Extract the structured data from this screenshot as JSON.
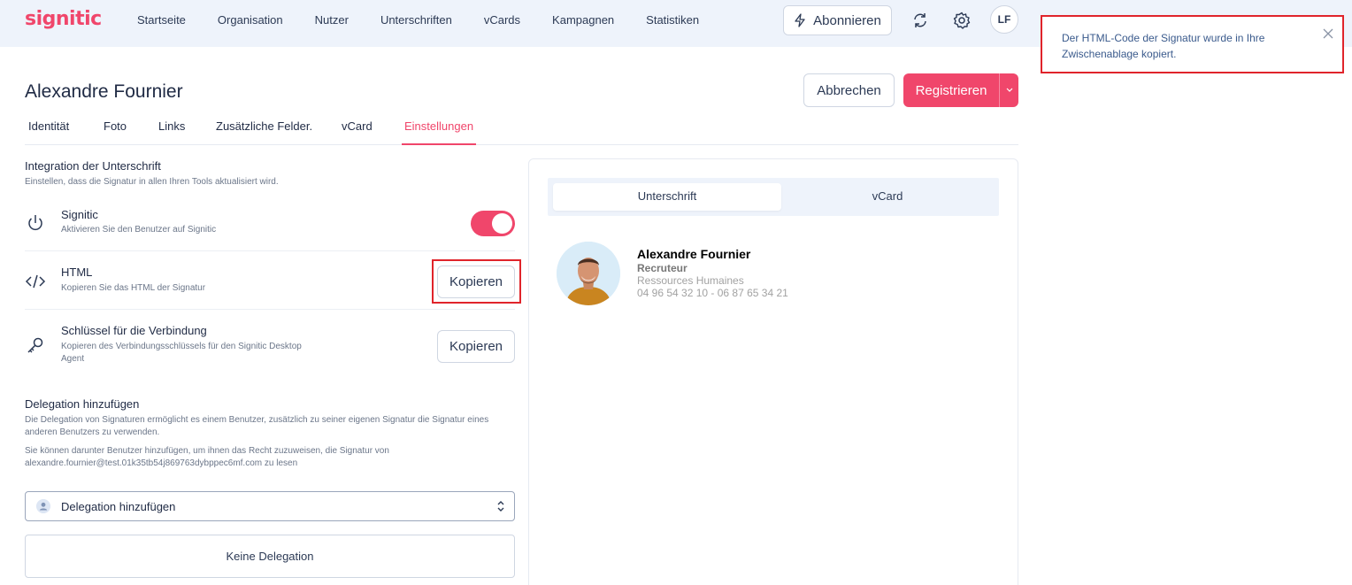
{
  "brand": {
    "name": "signitic",
    "accent": "#f0466b"
  },
  "nav": {
    "items": [
      "Startseite",
      "Organisation",
      "Nutzer",
      "Unterschriften",
      "vCards",
      "Kampagnen",
      "Statistiken"
    ],
    "subscribe_label": "Abonnieren",
    "user_initials": "LF"
  },
  "toast": {
    "message": "Der HTML-Code der Signatur wurde in Ihre Zwischenablage kopiert."
  },
  "header": {
    "title": "Alexandre Fournier",
    "cancel_label": "Abbrechen",
    "save_label": "Registrieren"
  },
  "tabs": [
    "Identität",
    "Foto",
    "Links",
    "Zusätzliche Felder.",
    "vCard",
    "Einstellungen"
  ],
  "active_tab": "Einstellungen",
  "integration": {
    "title": "Integration der Unterschrift",
    "subtitle": "Einstellen, dass die Signatur in allen Ihren Tools aktualisiert wird.",
    "rows": [
      {
        "title": "Signitic",
        "subtitle": "Aktivieren Sie den Benutzer auf Signitic",
        "toggle_on": true
      },
      {
        "title": "HTML",
        "subtitle": "Kopieren Sie das HTML der Signatur",
        "button": "Kopieren"
      },
      {
        "title": "Schlüssel für die Verbindung",
        "subtitle_line1": "Kopieren des Verbindungsschlüssels für den Signitic Desktop",
        "subtitle_line2": "Agent",
        "button": "Kopieren"
      }
    ]
  },
  "delegation": {
    "title": "Delegation hinzufügen",
    "desc1_line1": "Die Delegation von Signaturen ermöglicht es einem Benutzer, zusätzlich zu seiner eigenen Signatur die Signatur eines",
    "desc1_line2": "anderen Benutzers zu verwenden.",
    "desc2_line1": "Sie können darunter Benutzer hinzufügen, um ihnen das Recht zuzuweisen, die Signatur von",
    "desc2_line2": "alexandre.fournier@test.01k35tb54j869763dybppec6mf.com zu lesen",
    "select_label": "Delegation hinzufügen",
    "empty_label": "Keine Delegation"
  },
  "preview": {
    "tabs": [
      "Unterschrift",
      "vCard"
    ],
    "signature": {
      "name": "Alexandre Fournier",
      "job": "Recruteur",
      "department": "Ressources Humaines",
      "phone": "04 96 54 32 10 - 06 87 65 34 21"
    }
  }
}
